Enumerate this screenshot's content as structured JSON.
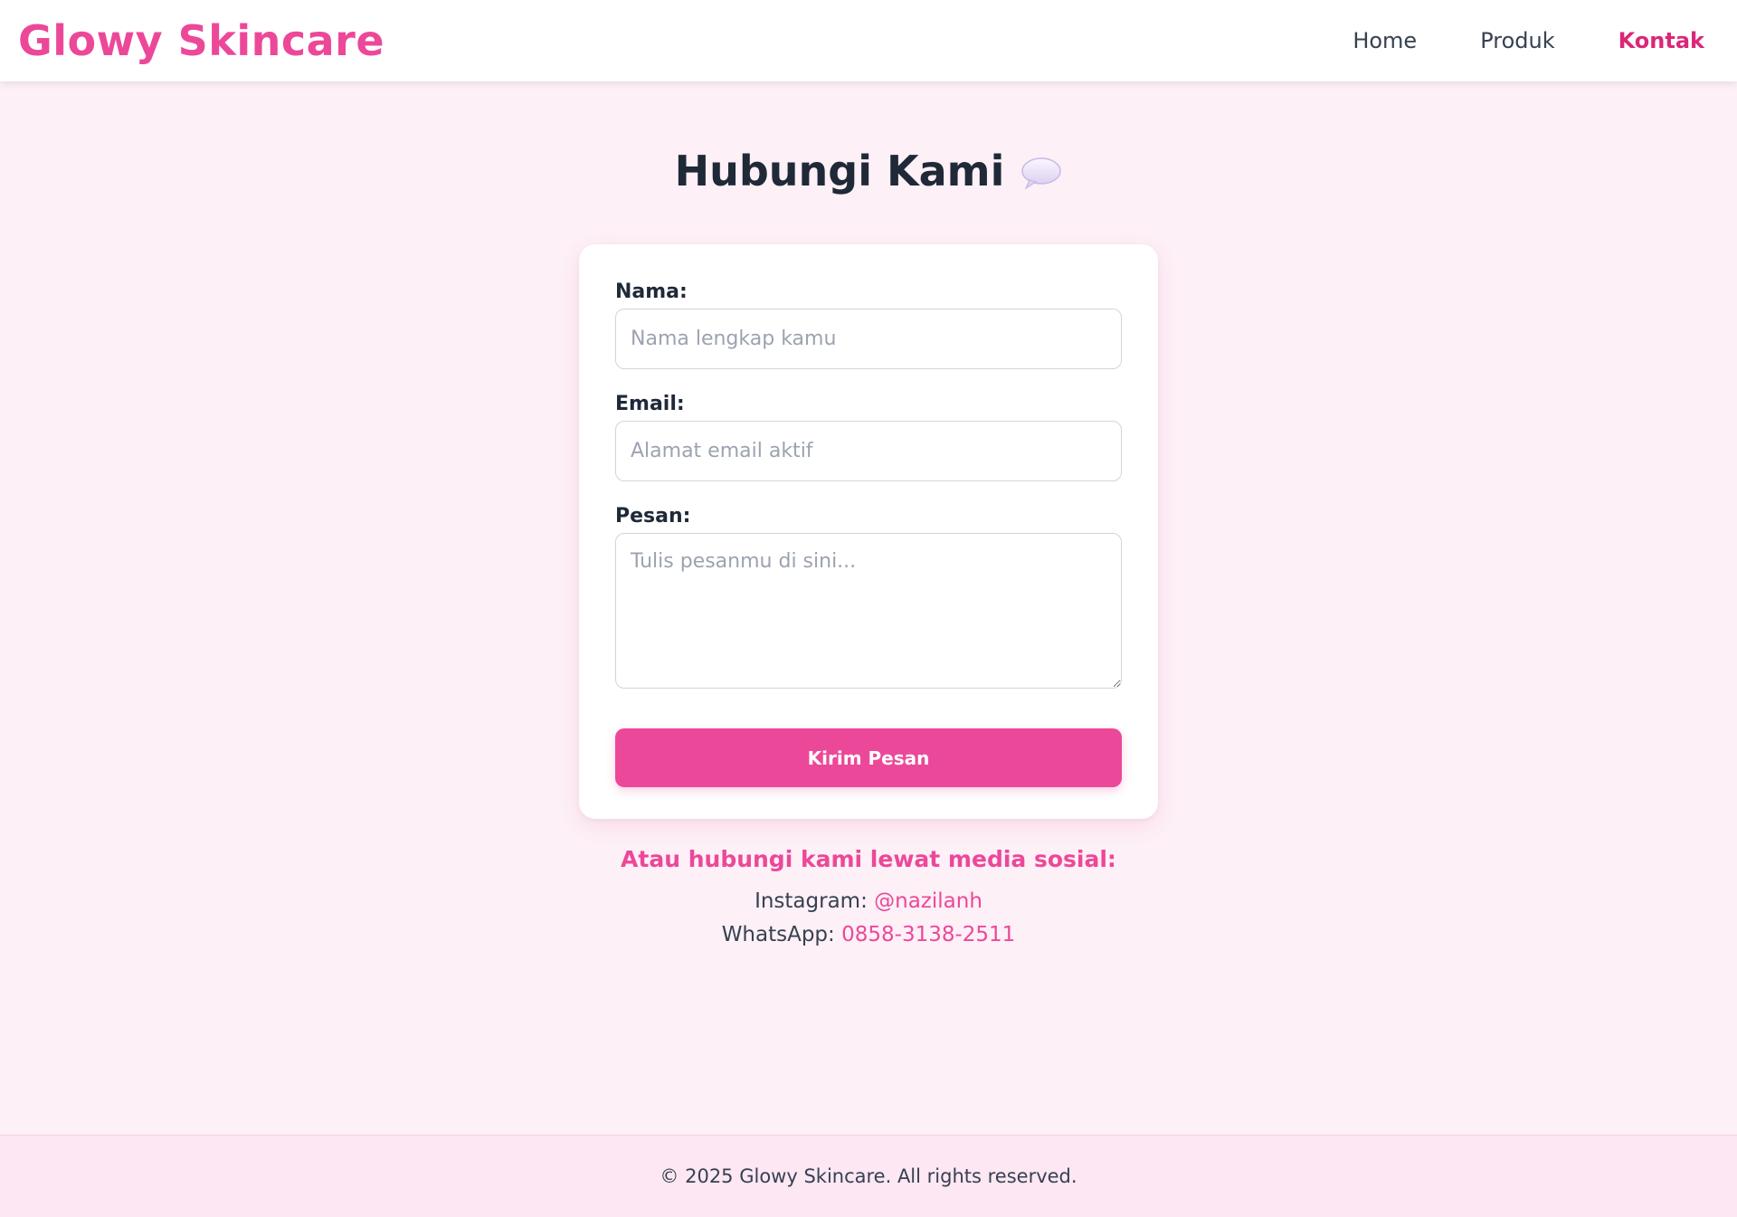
{
  "header": {
    "logo": "Glowy Skincare",
    "nav": [
      {
        "label": "Home",
        "active": false
      },
      {
        "label": "Produk",
        "active": false
      },
      {
        "label": "Kontak",
        "active": true
      }
    ]
  },
  "main": {
    "title": "Hubungi Kami",
    "title_icon": "speech-bubble-icon"
  },
  "form": {
    "name_label": "Nama:",
    "name_placeholder": "Nama lengkap kamu",
    "email_label": "Email:",
    "email_placeholder": "Alamat email aktif",
    "message_label": "Pesan:",
    "message_placeholder": "Tulis pesanmu di sini...",
    "submit_label": "Kirim Pesan"
  },
  "social": {
    "title": "Atau hubungi kami lewat media sosial:",
    "instagram_label": "Instagram:",
    "instagram_handle": "@nazilanh",
    "whatsapp_label": "WhatsApp:",
    "whatsapp_number": "0858-3138-2511"
  },
  "footer": {
    "text": "© 2025 Glowy Skincare. All rights reserved."
  },
  "colors": {
    "accent": "#ec4899",
    "accent_dark": "#db2777",
    "page_bg": "#fdf0f6",
    "footer_bg": "#fce7f3"
  }
}
